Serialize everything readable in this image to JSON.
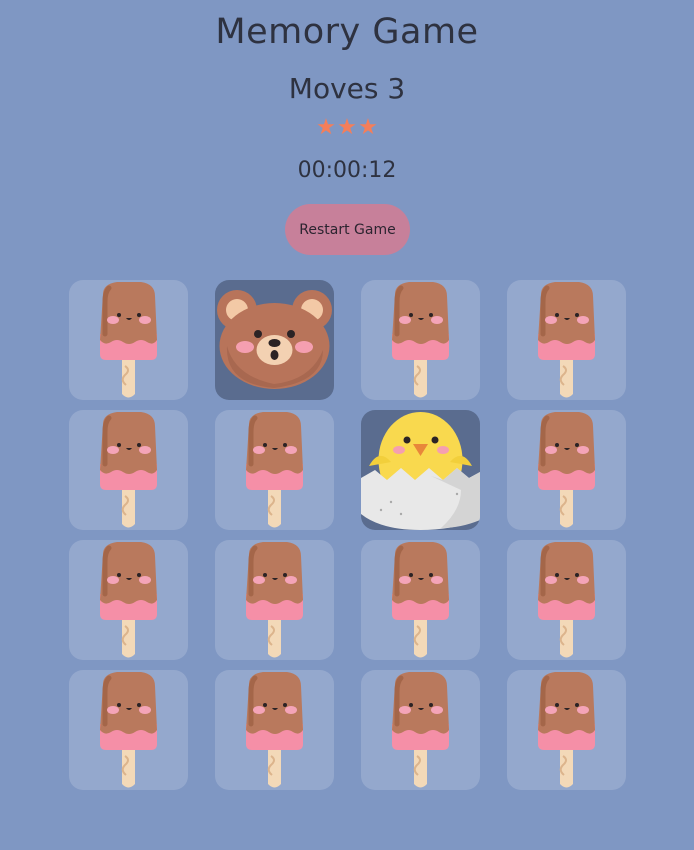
{
  "game": {
    "title": "Memory Game",
    "moves_label": "Moves 3",
    "moves": 3,
    "stars": 3,
    "timer": "00:00:12",
    "restart_label": "Restart Game"
  },
  "colors": {
    "background": "#7f97c3",
    "star": "#f47e5a",
    "restart_button": "#c7809a",
    "card_open": "#5a6c8f"
  },
  "cards": [
    {
      "state": "hidden",
      "icon": "popsicle-icon"
    },
    {
      "state": "open",
      "icon": "bear-icon"
    },
    {
      "state": "hidden",
      "icon": "popsicle-icon"
    },
    {
      "state": "hidden",
      "icon": "popsicle-icon"
    },
    {
      "state": "hidden",
      "icon": "popsicle-icon"
    },
    {
      "state": "hidden",
      "icon": "popsicle-icon"
    },
    {
      "state": "open",
      "icon": "chick-icon"
    },
    {
      "state": "hidden",
      "icon": "popsicle-icon"
    },
    {
      "state": "hidden",
      "icon": "popsicle-icon"
    },
    {
      "state": "hidden",
      "icon": "popsicle-icon"
    },
    {
      "state": "hidden",
      "icon": "popsicle-icon"
    },
    {
      "state": "hidden",
      "icon": "popsicle-icon"
    },
    {
      "state": "hidden",
      "icon": "popsicle-icon"
    },
    {
      "state": "hidden",
      "icon": "popsicle-icon"
    },
    {
      "state": "hidden",
      "icon": "popsicle-icon"
    },
    {
      "state": "hidden",
      "icon": "popsicle-icon"
    }
  ]
}
